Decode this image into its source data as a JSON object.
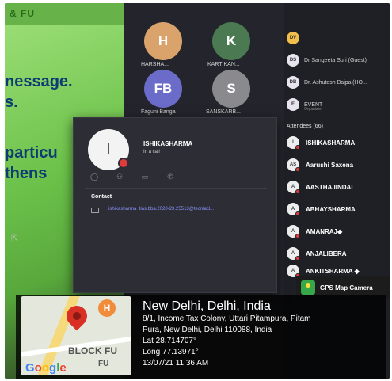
{
  "slide": {
    "top_text": "& FU",
    "lines": [
      "nessage.",
      "s.",
      "particu",
      "thens"
    ]
  },
  "meeting_tiles": [
    {
      "initial": "H",
      "label": "HARSHA...",
      "color": "#d9a36b"
    },
    {
      "initial": "K",
      "label": "KARTIKAN...",
      "color": "#4b7a52"
    },
    {
      "initial": "FB",
      "label": "Faguni Banga",
      "color": "#6b6bc9"
    },
    {
      "initial": "S",
      "label": "SANSKARB...",
      "color": "#8a8a8e"
    }
  ],
  "top_people": [
    {
      "initials": "DV",
      "name": "",
      "sub": ""
    },
    {
      "initials": "DS",
      "name": "Dr Sangeeta Suri (Guest)",
      "sub": ""
    },
    {
      "initials": "DB",
      "name": "Dr. Ashutosh Bajpai(HO...",
      "sub": ""
    },
    {
      "initials": "E",
      "name": "EVENT",
      "sub": "Organizer"
    }
  ],
  "attendees_header": "Attendees (66)",
  "attendees": [
    {
      "initials": "I",
      "name": "ISHIKASHARMA"
    },
    {
      "initials": "AS",
      "name": "Aarushi Saxena"
    },
    {
      "initials": "A",
      "name": "AASTHAJINDAL"
    },
    {
      "initials": "A",
      "name": "ABHAYSHARMA"
    },
    {
      "initials": "A",
      "name": "AMANRAJ◆"
    },
    {
      "initials": "A",
      "name": "ANJALIBERA"
    },
    {
      "initials": "A",
      "name": "ANKITSHARMA ◆"
    }
  ],
  "profile_card": {
    "initial": "I",
    "name": "ISHIKASHARMA",
    "status": "In a call",
    "contact_header": "Contact",
    "email": "ishikasharma_tias.bba.2020-23.25513@tecniacl..."
  },
  "gps": {
    "badge": "GPS Map Camera",
    "city": "New Delhi, Delhi, India",
    "address_line1": "8/1, Income Tax Colony, Uttari Pitampura, Pitam",
    "address_line2": "Pura, New Delhi, Delhi 110088, India",
    "lat": "Lat 28.714707°",
    "long": "Long 77.13971°",
    "datetime": "13/07/21 11:36 AM",
    "map_label": "BLOCK FU",
    "map_label2": "FU",
    "map_pin": "H",
    "google_letters": [
      "G",
      "o",
      "o",
      "g",
      "l",
      "e"
    ]
  },
  "colors": {
    "panel_bg": "#24252c",
    "card_bg": "#2d2e35",
    "busy_red": "#e03a3a",
    "link_purple": "#8d94ff",
    "slide_green": "#6cc24a",
    "slide_text": "#0d3b73"
  }
}
